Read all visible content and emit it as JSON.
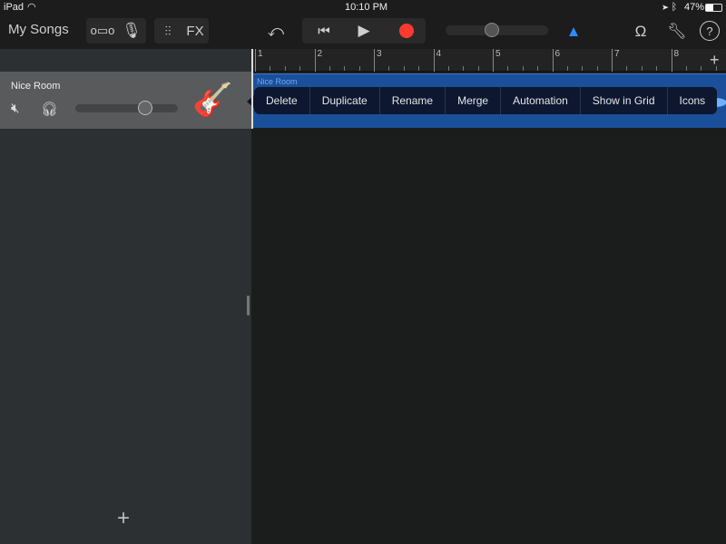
{
  "status": {
    "device": "iPad",
    "time": "10:10 PM",
    "battery": "47%"
  },
  "toolbar": {
    "my_songs": "My Songs",
    "fx": "FX"
  },
  "ruler": {
    "bars": [
      "1",
      "2",
      "3",
      "4",
      "5",
      "6",
      "7",
      "8"
    ]
  },
  "track": {
    "name": "Nice Room",
    "volume": 0.68,
    "instrument": "acoustic-guitar"
  },
  "region": {
    "name": "Nice Room"
  },
  "menu": {
    "items": [
      "Delete",
      "Duplicate",
      "Rename",
      "Merge",
      "Automation",
      "Show in Grid",
      "Icons"
    ]
  },
  "colors": {
    "accent": "#2a8cff",
    "record": "#ff3b30",
    "region": "#1b4f9a"
  }
}
